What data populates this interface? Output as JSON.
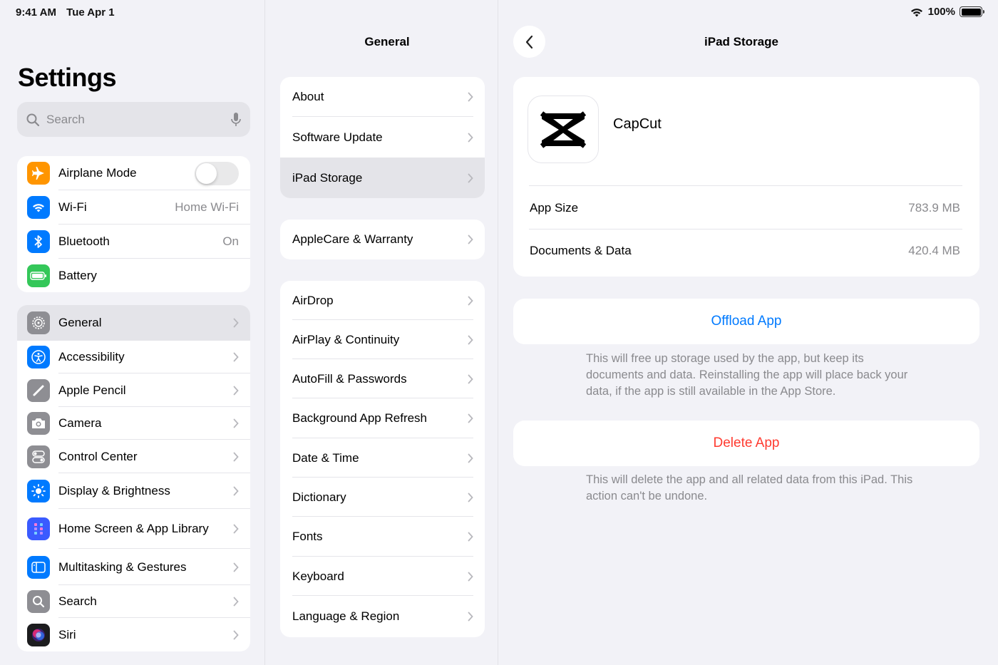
{
  "status": {
    "time": "9:41 AM",
    "date": "Tue Apr 1",
    "battery": "100%"
  },
  "sidebar": {
    "title": "Settings",
    "search_placeholder": "Search",
    "group1": [
      {
        "label": "Airplane Mode",
        "icon": "airplane-icon",
        "color": "#ff9500",
        "toggle": false
      },
      {
        "label": "Wi-Fi",
        "icon": "wifi-icon",
        "color": "#007aff",
        "value": "Home Wi-Fi"
      },
      {
        "label": "Bluetooth",
        "icon": "bluetooth-icon",
        "color": "#007aff",
        "value": "On"
      },
      {
        "label": "Battery",
        "icon": "battery-icon",
        "color": "#34c759"
      }
    ],
    "group2": [
      {
        "label": "General",
        "icon": "gear-icon",
        "color": "#8e8e93",
        "selected": true
      },
      {
        "label": "Accessibility",
        "icon": "accessibility-icon",
        "color": "#007aff"
      },
      {
        "label": "Apple Pencil",
        "icon": "pencil-icon",
        "color": "#8e8e93"
      },
      {
        "label": "Camera",
        "icon": "camera-icon",
        "color": "#8e8e93"
      },
      {
        "label": "Control Center",
        "icon": "control-center-icon",
        "color": "#8e8e93"
      },
      {
        "label": "Display & Brightness",
        "icon": "brightness-icon",
        "color": "#007aff"
      },
      {
        "label": "Home Screen & App Library",
        "icon": "home-screen-icon",
        "color": "#007aff"
      },
      {
        "label": "Multitasking & Gestures",
        "icon": "multitasking-icon",
        "color": "#007aff"
      },
      {
        "label": "Search",
        "icon": "search-icon",
        "color": "#8e8e93"
      },
      {
        "label": "Siri",
        "icon": "siri-icon",
        "color": "#1c1c1e"
      }
    ]
  },
  "general": {
    "title": "General",
    "groups": [
      [
        "About",
        "Software Update",
        "iPad Storage"
      ],
      [
        "AppleCare & Warranty"
      ],
      [
        "AirDrop",
        "AirPlay & Continuity",
        "AutoFill & Passwords",
        "Background App Refresh",
        "Date & Time",
        "Dictionary",
        "Fonts",
        "Keyboard",
        "Language & Region"
      ]
    ],
    "selected": "iPad Storage"
  },
  "detail": {
    "title": "iPad Storage",
    "app_name": "CapCut",
    "app_size_label": "App Size",
    "app_size_value": "783.9 MB",
    "docs_label": "Documents & Data",
    "docs_value": "420.4 MB",
    "offload_label": "Offload App",
    "offload_note": "This will free up storage used by the app, but keep its documents and data. Reinstalling the app will place back your data, if the app is still available in the App Store.",
    "delete_label": "Delete App",
    "delete_note": "This will delete the app and all related data from this iPad. This action can't be undone.",
    "colors": {
      "accent": "#007aff",
      "destructive": "#ff3b30"
    }
  }
}
